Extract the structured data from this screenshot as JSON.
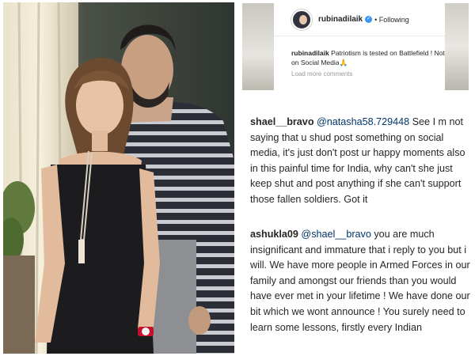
{
  "post": {
    "username": "rubinadilaik",
    "verified_icon": "verified-icon",
    "follow_status": "• Following",
    "caption_user": "rubinadilaik",
    "caption_text": "Patriotism is tested on Battlefield ! Not on Social Media🙏",
    "load_more": "Load more comments"
  },
  "comments": [
    {
      "user": "shael__bravo",
      "mention": "@natasha58.729448",
      "text": "See I m not saying that u shud post something on social media, it's just don't post ur happy moments also in this painful time for India, why can't she just keep shut and post anything if she can't support those fallen soldiers. Got it"
    },
    {
      "user": "ashukla09",
      "mention": "@shael__bravo",
      "text": "you are much insignificant and immature that i reply to you but i will. We have more people in Armed Forces in our family and amongst our friends than you would have ever met in your lifetime ! We have done our bit which we wont announce ! You surely need to learn some lessons, firstly every Indian"
    }
  ],
  "colors": {
    "text": "#262626",
    "mention": "#003569",
    "verified": "#3897f0",
    "muted": "#999999"
  }
}
